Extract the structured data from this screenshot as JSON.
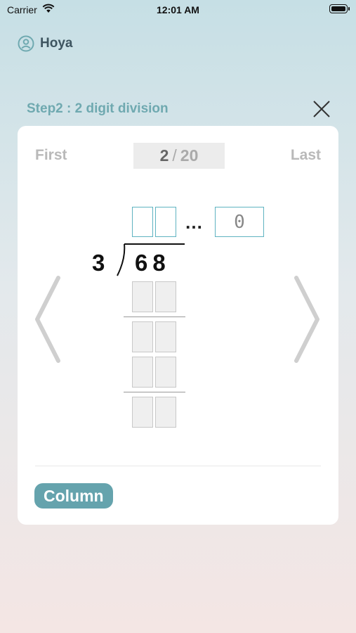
{
  "status_bar": {
    "carrier": "Carrier",
    "time": "12:01 AM"
  },
  "user": {
    "name": "Hoya",
    "icon": "user-circle-icon"
  },
  "step": {
    "title": "Step2 : 2 digit division"
  },
  "navigation": {
    "first_label": "First",
    "last_label": "Last",
    "current": "2",
    "separator": "/",
    "total": "20"
  },
  "problem": {
    "divisor": "3",
    "dividend": "68",
    "quotient_digits": [
      "",
      ""
    ],
    "ellipsis": "…",
    "remainder": "0"
  },
  "work_area": {
    "rows": 4,
    "cols": 2
  },
  "actions": {
    "column_label": "Column"
  },
  "colors": {
    "accent": "#65a3ad",
    "title": "#6fa9b0",
    "box_border": "#5fb3c1"
  }
}
